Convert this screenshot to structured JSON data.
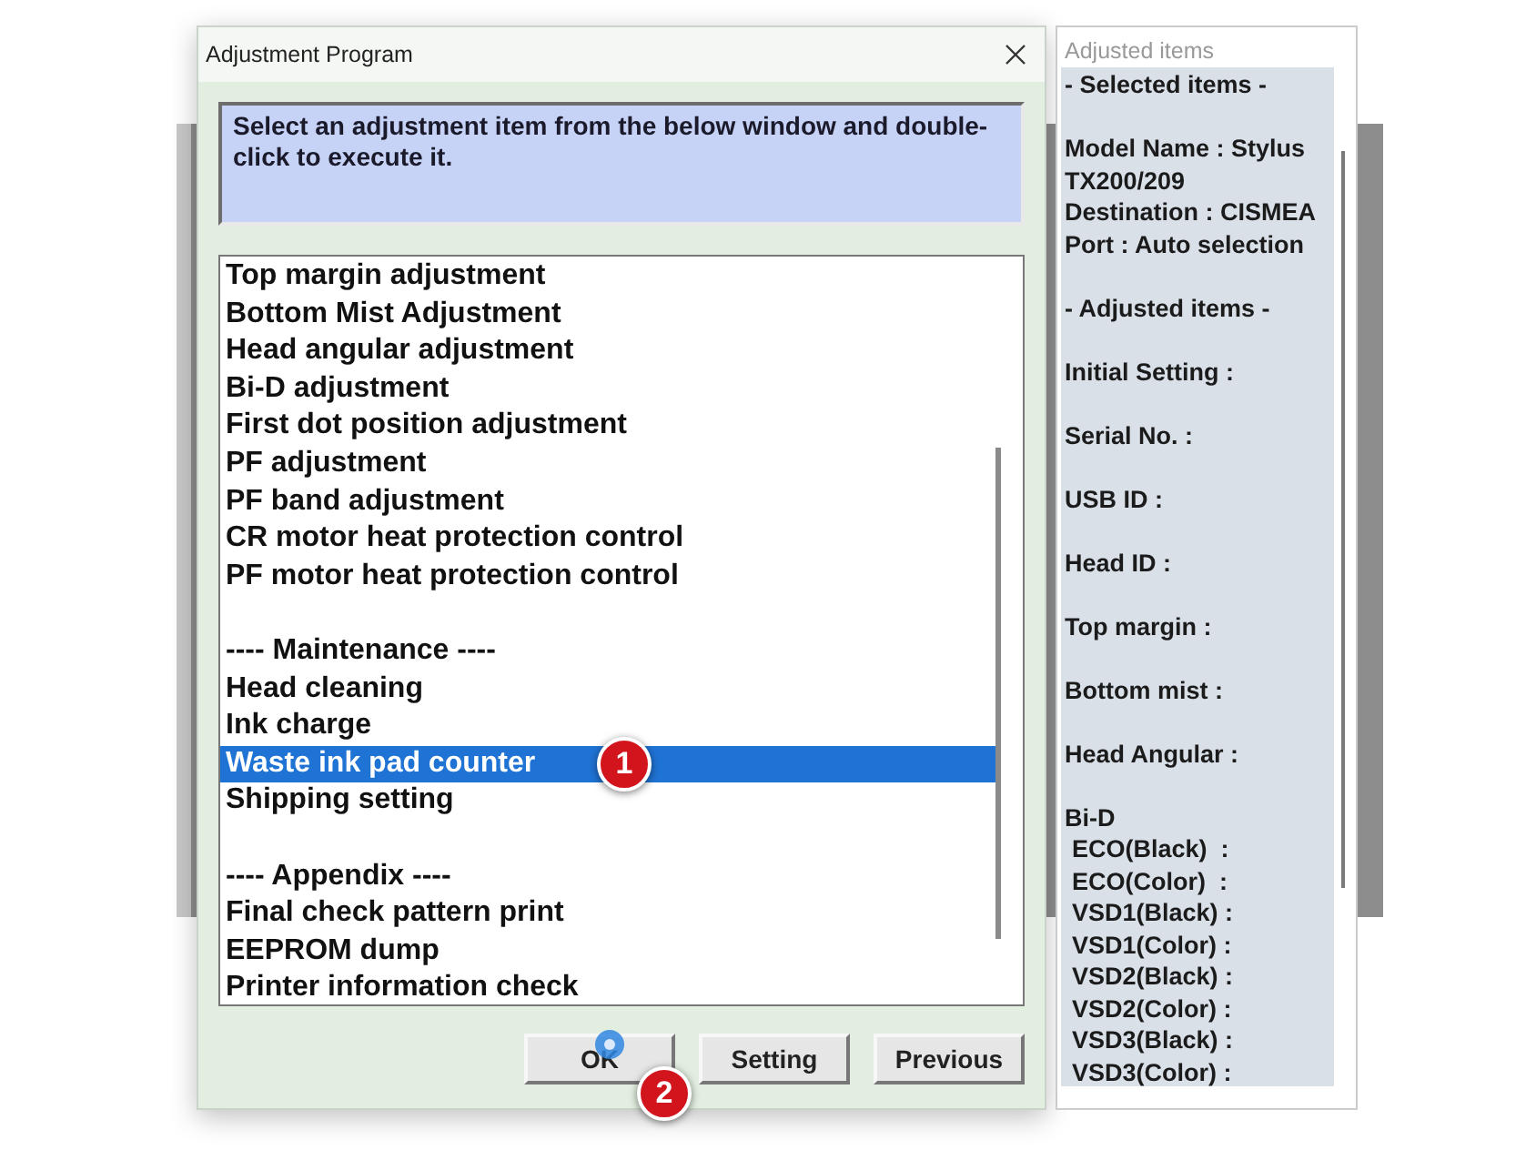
{
  "dialog": {
    "title": "Adjustment Program",
    "instruction": "Select an adjustment item from the below window and double-click to execute it.",
    "items": [
      {
        "text": "Top margin adjustment",
        "kind": "item",
        "selected": false
      },
      {
        "text": "Bottom Mist Adjustment",
        "kind": "item",
        "selected": false
      },
      {
        "text": "Head angular adjustment",
        "kind": "item",
        "selected": false
      },
      {
        "text": "Bi-D adjustment",
        "kind": "item",
        "selected": false
      },
      {
        "text": "First dot position adjustment",
        "kind": "item",
        "selected": false
      },
      {
        "text": "PF adjustment",
        "kind": "item",
        "selected": false
      },
      {
        "text": "PF band adjustment",
        "kind": "item",
        "selected": false
      },
      {
        "text": "CR motor heat protection control",
        "kind": "item",
        "selected": false
      },
      {
        "text": "PF motor heat protection control",
        "kind": "item",
        "selected": false
      },
      {
        "text": "---- Maintenance ----",
        "kind": "heading",
        "selected": false
      },
      {
        "text": "Head cleaning",
        "kind": "item",
        "selected": false
      },
      {
        "text": "Ink charge",
        "kind": "item",
        "selected": false
      },
      {
        "text": "Waste ink pad counter",
        "kind": "item",
        "selected": true
      },
      {
        "text": "Shipping setting",
        "kind": "item",
        "selected": false
      },
      {
        "text": "---- Appendix ----",
        "kind": "heading",
        "selected": false
      },
      {
        "text": "Final check pattern print",
        "kind": "item",
        "selected": false
      },
      {
        "text": "EEPROM dump",
        "kind": "item",
        "selected": false
      },
      {
        "text": "Printer information check",
        "kind": "item",
        "selected": false
      }
    ],
    "buttons": [
      {
        "label": "OK"
      },
      {
        "label": "Setting"
      },
      {
        "label": "Previous"
      }
    ]
  },
  "side_panel": {
    "title": "Adjusted items",
    "lines": [
      {
        "text": "- Selected items -",
        "kind": "line"
      },
      {
        "text": "Model Name : Stylus TX200/209",
        "kind": "spaced"
      },
      {
        "text": "Destination : CISMEA",
        "kind": "line"
      },
      {
        "text": "Port : Auto selection",
        "kind": "line"
      },
      {
        "text": "- Adjusted items -",
        "kind": "spaced"
      },
      {
        "text": "Initial Setting :",
        "kind": "spaced"
      },
      {
        "text": "Serial No. :",
        "kind": "spaced"
      },
      {
        "text": "USB ID :",
        "kind": "spaced"
      },
      {
        "text": "Head ID :",
        "kind": "spaced"
      },
      {
        "text": "Top margin :",
        "kind": "spaced"
      },
      {
        "text": "Bottom mist :",
        "kind": "spaced"
      },
      {
        "text": "Head Angular :",
        "kind": "spaced"
      },
      {
        "text": "Bi-D",
        "kind": "spaced"
      },
      {
        "text": "ECO(Black)  :",
        "kind": "sub"
      },
      {
        "text": "ECO(Color)  :",
        "kind": "sub"
      },
      {
        "text": "VSD1(Black) :",
        "kind": "sub"
      },
      {
        "text": "VSD1(Color) :",
        "kind": "sub"
      },
      {
        "text": "VSD2(Black) :",
        "kind": "sub"
      },
      {
        "text": "VSD2(Color) :",
        "kind": "sub"
      },
      {
        "text": "VSD3(Black) :",
        "kind": "sub"
      },
      {
        "text": "VSD3(Color) :",
        "kind": "sub"
      }
    ]
  },
  "step_badges": [
    {
      "label": "1"
    },
    {
      "label": "2"
    }
  ]
}
